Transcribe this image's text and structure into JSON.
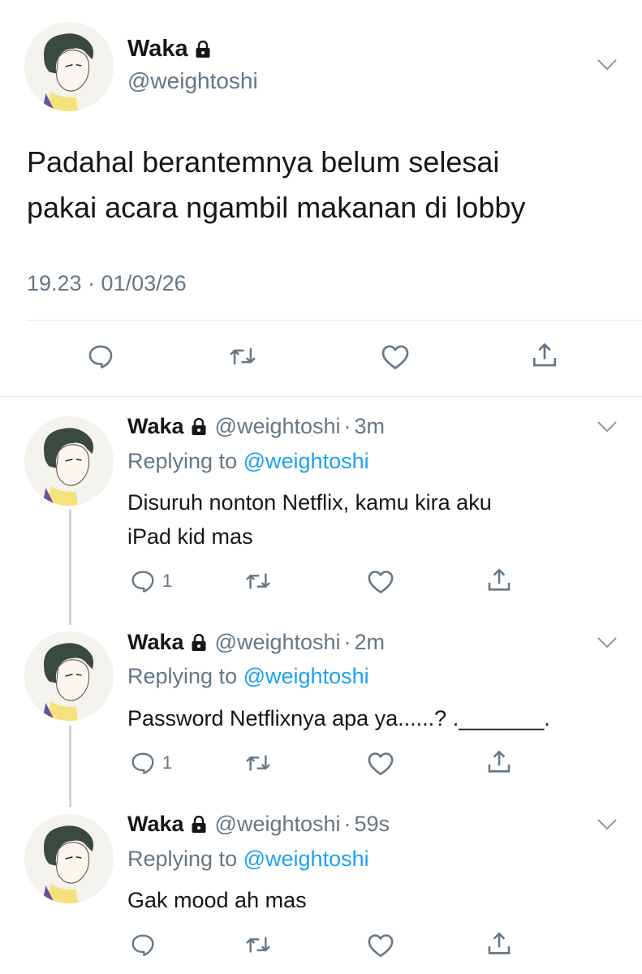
{
  "main_tweet": {
    "name": "Waka",
    "handle": "@weightoshi",
    "text_line1": "Padahal berantemnya belum selesai",
    "text_line2": "pakai acara ngambil makanan di lobby",
    "timestamp": "19.23 · 01/03/26",
    "icons": [
      "lock-icon",
      "chevron-down-icon",
      "reply-icon",
      "retweet-icon",
      "like-icon",
      "share-icon"
    ]
  },
  "replies": [
    {
      "name": "Waka",
      "handle": "@weightoshi",
      "dot": "·",
      "time": "3m",
      "replying_prefix": "Replying to",
      "replying_to": "@weightoshi",
      "text_line1": "Disuruh nonton Netflix, kamu kira aku",
      "text_line2": "iPad kid mas",
      "reply_count": "1"
    },
    {
      "name": "Waka",
      "handle": "@weightoshi",
      "dot": "·",
      "time": "2m",
      "replying_prefix": "Replying to",
      "replying_to": "@weightoshi",
      "text_line1": "Password Netflixnya apa ya......? ._______.",
      "text_line2": "",
      "reply_count": "1"
    },
    {
      "name": "Waka",
      "handle": "@weightoshi",
      "dot": "·",
      "time": "59s",
      "replying_prefix": "Replying to",
      "replying_to": "@weightoshi",
      "text_line1": "Gak mood ah mas",
      "text_line2": "",
      "reply_count": ""
    }
  ],
  "colors": {
    "text": "#14171a",
    "secondary": "#657786",
    "link": "#1da1f2",
    "divider": "#e1e8ed"
  }
}
